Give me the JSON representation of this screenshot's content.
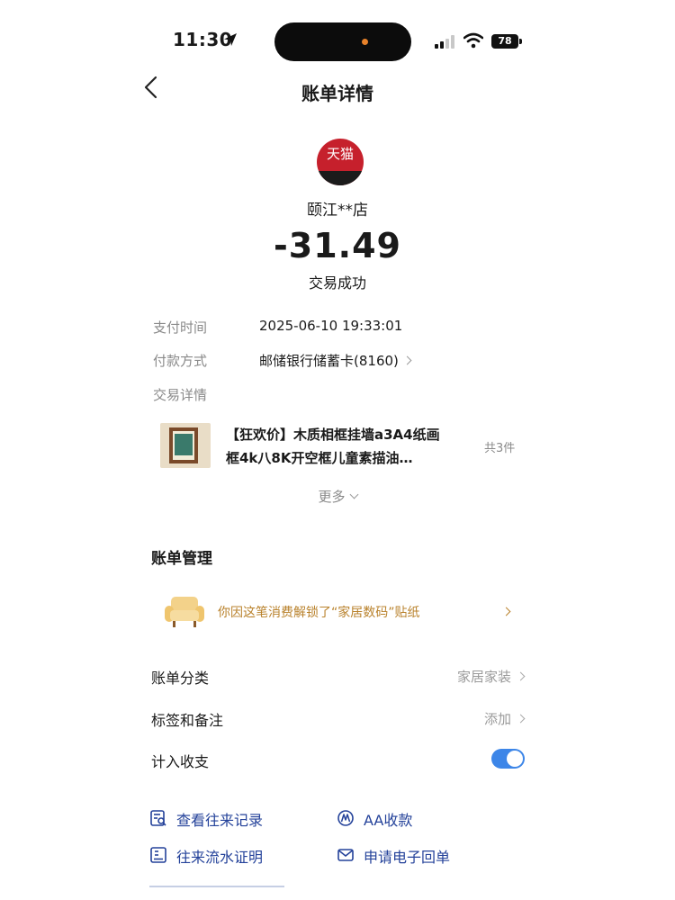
{
  "status_bar": {
    "time": "11:30",
    "battery": "78"
  },
  "header": {
    "title": "账单详情"
  },
  "merchant": {
    "logo_text": "天猫",
    "name": "颐江**店",
    "amount": "-31.49",
    "status": "交易成功"
  },
  "details": {
    "pay_time": {
      "label": "支付时间",
      "value": "2025-06-10 19:33:01"
    },
    "pay_method": {
      "label": "付款方式",
      "value": "邮储银行储蓄卡(8160)"
    },
    "trade_detail": {
      "label": "交易详情"
    }
  },
  "product": {
    "title": "【狂欢价】木质相框挂墙a3A4纸画框4k八8K开空框儿童素描油…",
    "count": "共3件"
  },
  "more_label": "更多",
  "management": {
    "title": "账单管理",
    "sticker_text": "你因这笔消费解锁了“家居数码”贴纸",
    "category": {
      "label": "账单分类",
      "value": "家居家装"
    },
    "tags": {
      "label": "标签和备注",
      "value": "添加"
    },
    "count_in": {
      "label": "计入收支",
      "enabled": true
    }
  },
  "actions": [
    {
      "label": "查看往来记录",
      "icon": "record-search-icon"
    },
    {
      "label": "AA收款",
      "icon": "aa-collect-icon"
    },
    {
      "label": "往来流水证明",
      "icon": "statement-proof-icon"
    },
    {
      "label": "申请电子回单",
      "icon": "mail-receipt-icon"
    }
  ],
  "colors": {
    "accent": "#3d86e8",
    "link": "#24429a",
    "sticker": "#b9822c",
    "tmall_red": "#c6202c"
  }
}
